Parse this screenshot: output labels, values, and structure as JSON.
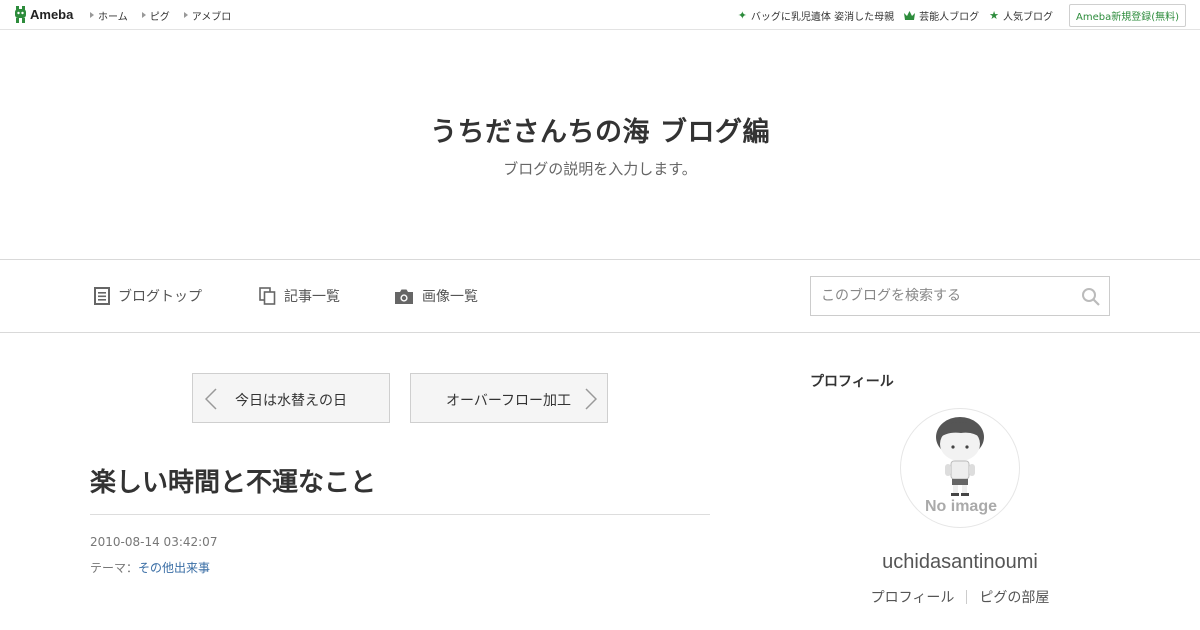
{
  "topbar": {
    "logo": "Ameba",
    "nav": [
      "ホーム",
      "ピグ",
      "アメブロ"
    ],
    "right": [
      {
        "icon": "sparkle-icon",
        "label": "バッグに乳児遺体 姿消した母親"
      },
      {
        "icon": "crown-icon",
        "label": "芸能人ブログ"
      },
      {
        "icon": "star-icon",
        "label": "人気ブログ"
      }
    ],
    "signup": "Ameba新規登録(無料)"
  },
  "header": {
    "title": "うちださんちの海 ブログ編",
    "description": "ブログの説明を入力します。"
  },
  "nav": {
    "blog_top": "ブログトップ",
    "entry_list": "記事一覧",
    "image_list": "画像一覧",
    "search_placeholder": "このブログを検索する"
  },
  "pager": {
    "prev": "今日は水替えの日",
    "next": "オーバーフロー加工"
  },
  "entry": {
    "title": "楽しい時間と不運なこと",
    "date": "2010-08-14 03:42:07",
    "theme_label": "テーマ：",
    "theme": "その他出来事"
  },
  "sidebar": {
    "heading": "プロフィール",
    "avatar_text": "No image",
    "username": "uchidasantinoumi",
    "links": [
      "プロフィール",
      "ピグの部屋"
    ]
  },
  "colors": {
    "accent_green": "#2d8c3c",
    "link_blue": "#3a6ea5"
  }
}
